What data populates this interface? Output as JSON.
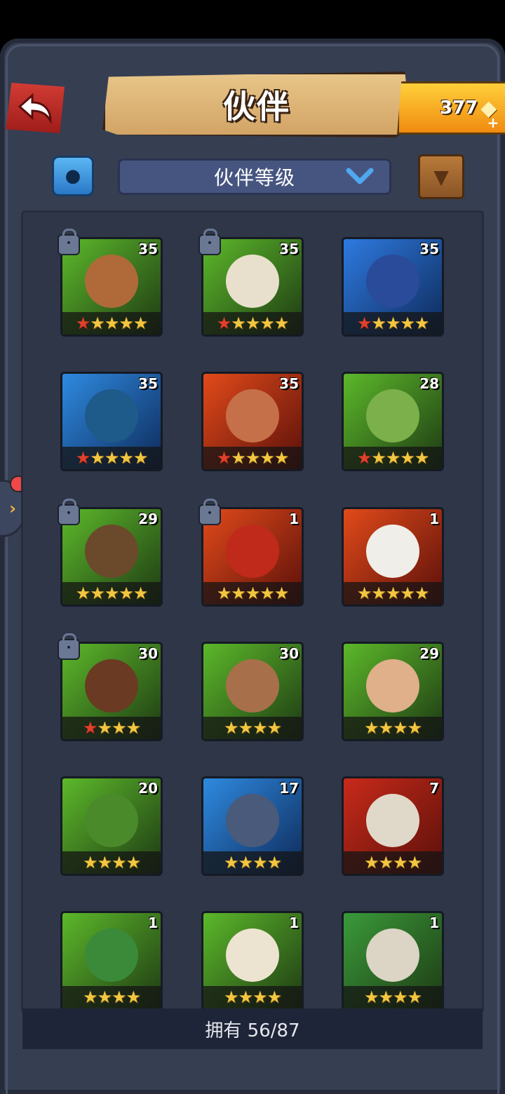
{
  "header": {
    "title": "伙伴",
    "gems": "377"
  },
  "filter": {
    "label": "伙伴等级"
  },
  "companions": [
    {
      "level": "35",
      "stars": 5,
      "red": 1,
      "locked": true,
      "bg": "#5cb82a",
      "face": "#b06a3a"
    },
    {
      "level": "35",
      "stars": 5,
      "red": 1,
      "locked": true,
      "bg": "#5cb82a",
      "face": "#e8e0cc"
    },
    {
      "level": "35",
      "stars": 5,
      "red": 1,
      "locked": false,
      "bg": "#2e7ae0",
      "face": "#2a4a9a"
    },
    {
      "level": "35",
      "stars": 5,
      "red": 1,
      "locked": false,
      "bg": "#2e8ae0",
      "face": "#1e5a8a"
    },
    {
      "level": "35",
      "stars": 5,
      "red": 1,
      "locked": false,
      "bg": "#e24a1a",
      "face": "#c6704a"
    },
    {
      "level": "28",
      "stars": 5,
      "red": 1,
      "locked": false,
      "bg": "#5cb82a",
      "face": "#7cb04a"
    },
    {
      "level": "29",
      "stars": 5,
      "red": 0,
      "locked": true,
      "bg": "#5cb82a",
      "face": "#6a4a2a"
    },
    {
      "level": "1",
      "stars": 5,
      "red": 0,
      "locked": true,
      "bg": "#e24a1a",
      "face": "#c02a1a"
    },
    {
      "level": "1",
      "stars": 5,
      "red": 0,
      "locked": false,
      "bg": "#e24a1a",
      "face": "#f0eee8"
    },
    {
      "level": "30",
      "stars": 4,
      "red": 1,
      "locked": true,
      "bg": "#5cb82a",
      "face": "#6a3a22"
    },
    {
      "level": "30",
      "stars": 4,
      "red": 0,
      "locked": false,
      "bg": "#5cb82a",
      "face": "#a8704a"
    },
    {
      "level": "29",
      "stars": 4,
      "red": 0,
      "locked": false,
      "bg": "#5cb82a",
      "face": "#e0b08a"
    },
    {
      "level": "20",
      "stars": 4,
      "red": 0,
      "locked": false,
      "bg": "#5cb82a",
      "face": "#4a8a2a"
    },
    {
      "level": "17",
      "stars": 4,
      "red": 0,
      "locked": false,
      "bg": "#2e8ae0",
      "face": "#4a5a7a"
    },
    {
      "level": "7",
      "stars": 4,
      "red": 0,
      "locked": false,
      "bg": "#c82a1a",
      "face": "#e0d8c8"
    },
    {
      "level": "1",
      "stars": 4,
      "red": 0,
      "locked": false,
      "bg": "#5cb82a",
      "face": "#3a8a3a"
    },
    {
      "level": "1",
      "stars": 4,
      "red": 0,
      "locked": false,
      "bg": "#5cb82a",
      "face": "#ece4d0"
    },
    {
      "level": "1",
      "stars": 4,
      "red": 0,
      "locked": false,
      "bg": "#3a9a3a",
      "face": "#dcd4c4"
    }
  ],
  "footer": {
    "owned": "拥有 56/87"
  }
}
